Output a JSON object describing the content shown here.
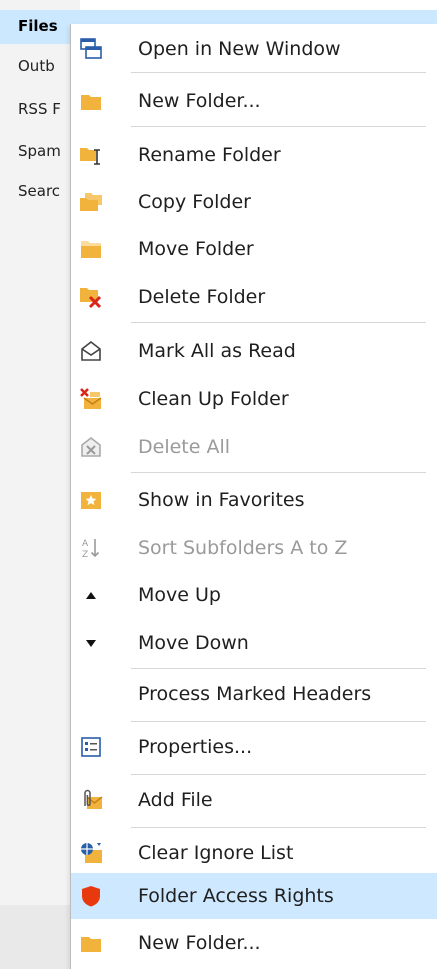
{
  "folder_pane": {
    "items": [
      "Files",
      "Outb",
      "RSS F",
      "Spam",
      "Searc"
    ]
  },
  "menu": {
    "items": [
      {
        "label": "Open in New Window",
        "icon": "new-window-icon"
      },
      {
        "label": "New Folder...",
        "icon": "folder-icon"
      },
      {
        "label": "Rename Folder",
        "icon": "rename-folder-icon"
      },
      {
        "label": "Copy Folder",
        "icon": "copy-folder-icon"
      },
      {
        "label": "Move Folder",
        "icon": "move-folder-icon"
      },
      {
        "label": "Delete Folder",
        "icon": "delete-folder-icon"
      },
      {
        "label": "Mark All as Read",
        "icon": "open-envelope-icon"
      },
      {
        "label": "Clean Up Folder",
        "icon": "clean-up-icon"
      },
      {
        "label": "Delete All",
        "icon": "delete-all-icon",
        "disabled": true
      },
      {
        "label": "Show in Favorites",
        "icon": "favorites-star-icon"
      },
      {
        "label": "Sort Subfolders A to Z",
        "icon": "sort-az-icon",
        "disabled": true
      },
      {
        "label": "Move Up",
        "icon": "triangle-up-icon"
      },
      {
        "label": "Move Down",
        "icon": "triangle-down-icon"
      },
      {
        "label": "Process Marked Headers",
        "icon": ""
      },
      {
        "label": "Properties...",
        "icon": "properties-icon"
      },
      {
        "label": "Add File",
        "icon": "paperclip-envelope-icon"
      },
      {
        "label": "Clear Ignore List",
        "icon": "clear-ignore-icon"
      },
      {
        "label": "Folder Access Rights",
        "icon": "shield-icon",
        "highlighted": true
      },
      {
        "label": "New Folder...",
        "icon": "folder-icon"
      }
    ]
  },
  "colors": {
    "highlight": "#cde8ff",
    "folder_yellow": "#f2b33d",
    "shield_red": "#e8390e",
    "delete_red": "#d9261c",
    "icon_blue": "#2a5ea8"
  }
}
